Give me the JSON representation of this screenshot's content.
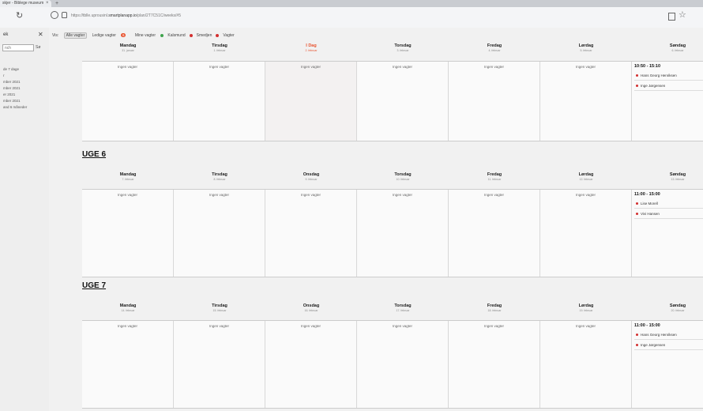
{
  "browser": {
    "tab_title": "skjer - Biblege museum",
    "url_prefix": "https://tblle.uprousinl.",
    "url_host": "smartplanapp.io",
    "url_path": "/plan/2T7C51C/weeks/#5"
  },
  "sidebar": {
    "title": "ek",
    "search_placeholder": "nch",
    "search_button": "Sø",
    "items": [
      "de 7 dage",
      "r",
      "mber 2021",
      "mber 2021",
      "er 2021",
      "mber 2021",
      "and 6 måneder"
    ]
  },
  "filters": {
    "label": "Vis:",
    "all": "Alle vagter",
    "free": "Ledige vagter",
    "free_count": "6",
    "mine": "Mine vagter",
    "legend": [
      {
        "label": "Kalsmund",
        "color": "#3fa34d"
      },
      {
        "label": "Smedjen",
        "color": "#d32f2f"
      },
      {
        "label": "Vagter",
        "color": "#d32f2f"
      }
    ]
  },
  "weeks": [
    {
      "title": "",
      "days": [
        {
          "name": "Mandag",
          "date": "31. januar",
          "today": false,
          "empty": "Ingen vagter"
        },
        {
          "name": "Tirsdag",
          "date": "1. februar",
          "today": false,
          "empty": "Ingen vagter"
        },
        {
          "name": "I Dag",
          "date": "2. februar",
          "today": true,
          "empty": "Ingen vagter"
        },
        {
          "name": "Torsdag",
          "date": "3. februar",
          "today": false,
          "empty": "Ingen vagter"
        },
        {
          "name": "Fredag",
          "date": "4. februar",
          "today": false,
          "empty": "Ingen vagter"
        },
        {
          "name": "Lørdag",
          "date": "5. februar",
          "today": false,
          "empty": "Ingen vagter"
        },
        {
          "name": "Søndag",
          "date": "6. februar",
          "today": false,
          "shift_time": "10:50 - 15:10",
          "people": [
            "Hans Georg Henriksen",
            "Inge Jørgensen"
          ]
        }
      ]
    },
    {
      "title": "UGE 6",
      "days": [
        {
          "name": "Mandag",
          "date": "7. februar",
          "today": false,
          "empty": "Ingen vagter"
        },
        {
          "name": "Tirsdag",
          "date": "8. februar",
          "today": false,
          "empty": "Ingen vagter"
        },
        {
          "name": "Onsdag",
          "date": "9. februar",
          "today": false,
          "empty": "Ingen vagter"
        },
        {
          "name": "Torsdag",
          "date": "10. februar",
          "today": false,
          "empty": "Ingen vagter"
        },
        {
          "name": "Fredag",
          "date": "11. februar",
          "today": false,
          "empty": "Ingen vagter"
        },
        {
          "name": "Lørdag",
          "date": "12. februar",
          "today": false,
          "empty": "Ingen vagter"
        },
        {
          "name": "Søndag",
          "date": "13. februar",
          "today": false,
          "shift_time": "11:00 - 15:00",
          "people": [
            "Lise Morell",
            "Vivi Hansen"
          ]
        }
      ]
    },
    {
      "title": "UGE 7",
      "days": [
        {
          "name": "Mandag",
          "date": "14. februar",
          "today": false,
          "empty": "Ingen vagter"
        },
        {
          "name": "Tirsdag",
          "date": "15. februar",
          "today": false,
          "empty": "Ingen vagter"
        },
        {
          "name": "Onsdag",
          "date": "16. februar",
          "today": false,
          "empty": "Ingen vagter"
        },
        {
          "name": "Torsdag",
          "date": "17. februar",
          "today": false,
          "empty": "Ingen vagter"
        },
        {
          "name": "Fredag",
          "date": "18. februar",
          "today": false,
          "empty": "Ingen vagter"
        },
        {
          "name": "Lørdag",
          "date": "19. februar",
          "today": false,
          "empty": "Ingen vagter"
        },
        {
          "name": "Søndag",
          "date": "20. februar",
          "today": false,
          "shift_time": "11:00 - 15:00",
          "people": [
            "Hans Georg Henriksen",
            "Inge Jørgensen"
          ]
        }
      ]
    }
  ]
}
